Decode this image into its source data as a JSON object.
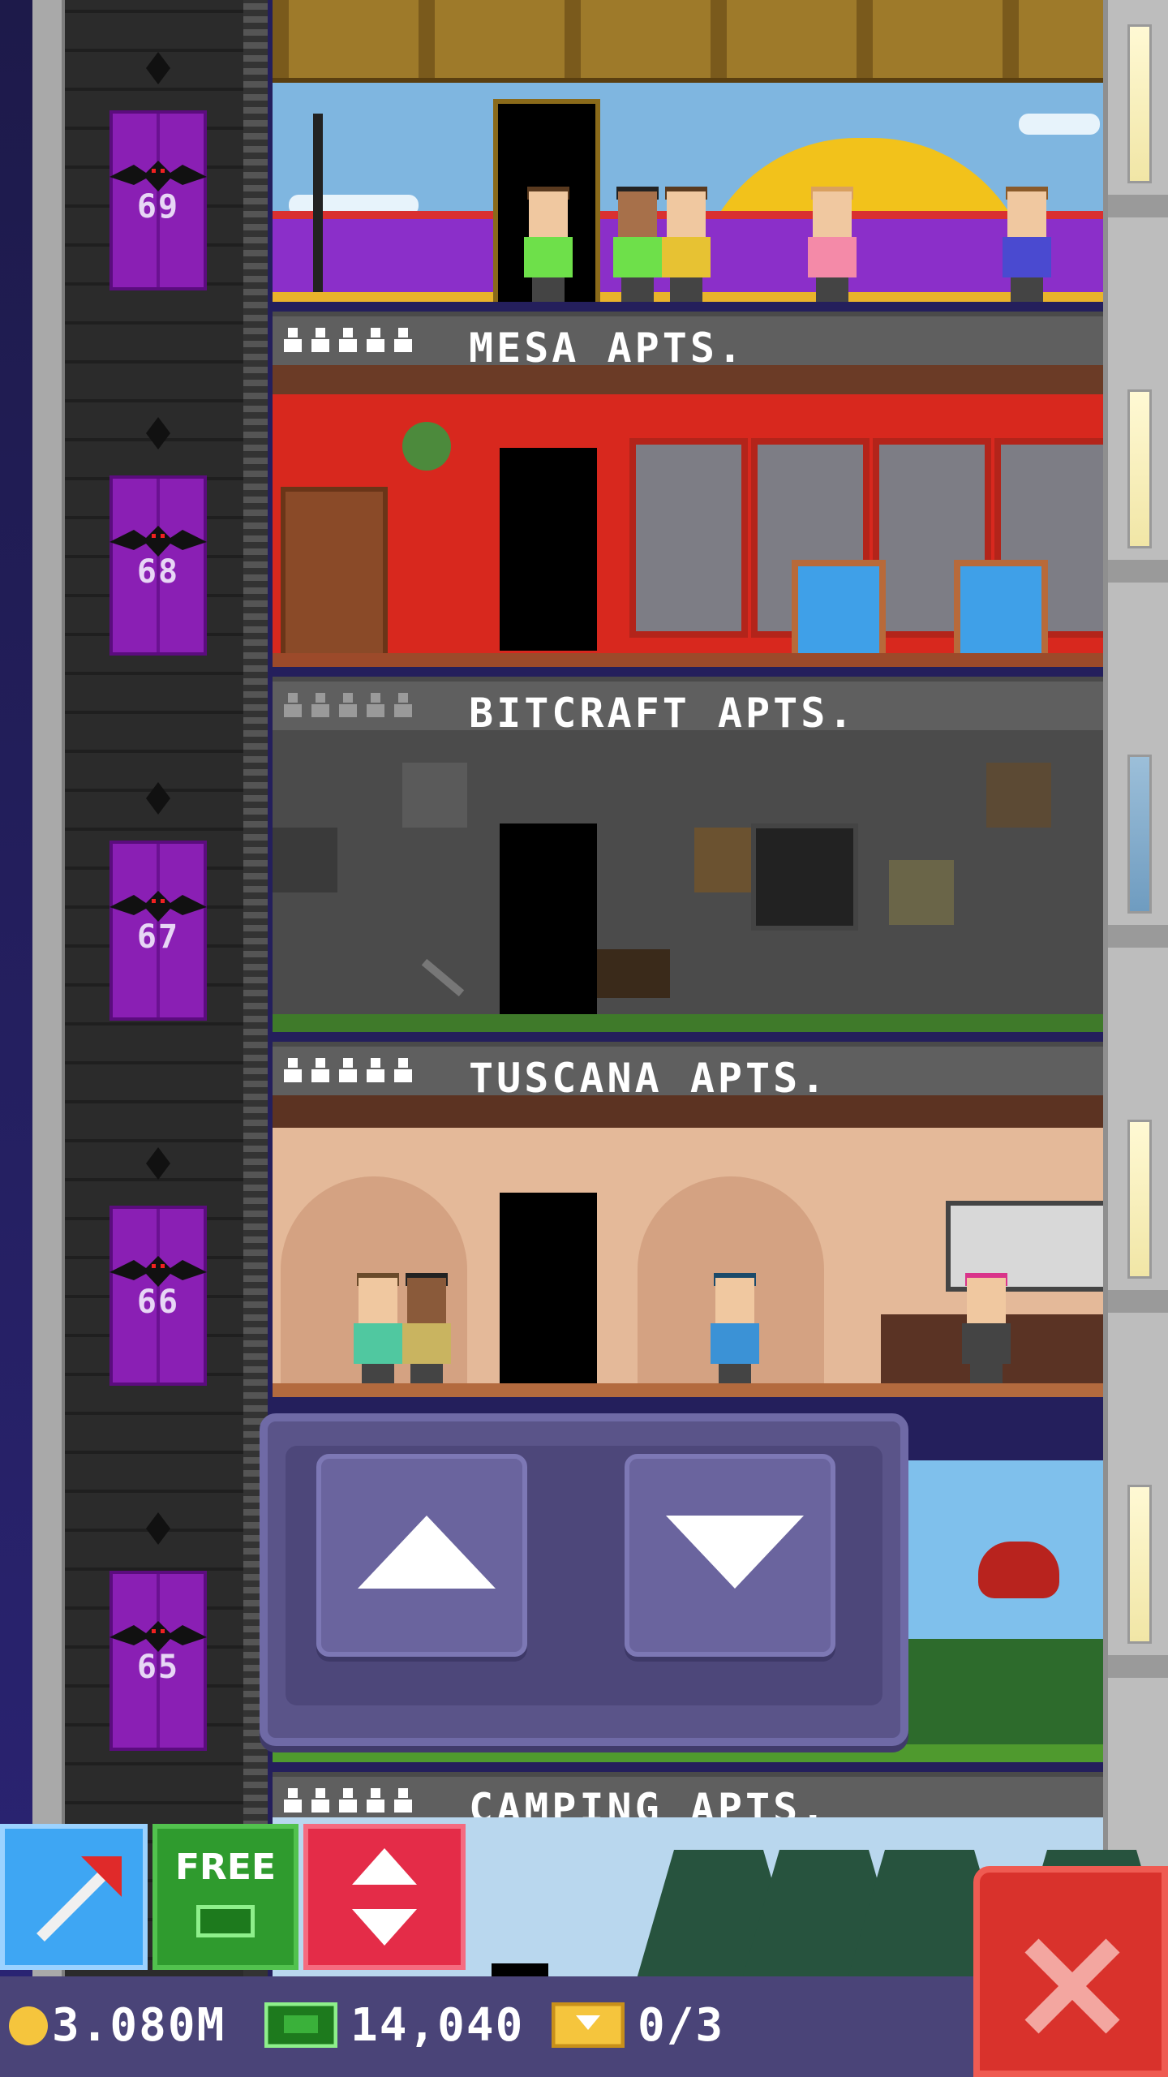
{
  "floors": [
    {
      "number": "69",
      "name": "MESA APTS.",
      "residents_filled": 5,
      "people_color": "#ffffff"
    },
    {
      "number": "68",
      "name": "BITCRAFT APTS.",
      "residents_filled": 0,
      "people_color": "#9a9a9a"
    },
    {
      "number": "67",
      "name": "TUSCANA APTS.",
      "residents_filled": 5,
      "people_color": "#ffffff"
    },
    {
      "number": "66",
      "name": "CAMPING APTS.",
      "residents_filled": 5,
      "people_color": "#ffffff"
    },
    {
      "number": "65"
    }
  ],
  "toolbar": {
    "dig_icon": "pickaxe-arrow-icon",
    "free_label": "FREE",
    "elevator_icon": "up-down-arrows-icon",
    "close_icon": "close-x-icon"
  },
  "status": {
    "coins": "3.080M",
    "bux": "14,040",
    "tickets": "0/3"
  },
  "elevator_control": {
    "up_icon": "arrow-up-icon",
    "down_icon": "arrow-down-icon"
  },
  "colors": {
    "elevator": "#8a1fb4",
    "control_panel": "#5a5489",
    "dig_button": "#3ea6f3",
    "free_button": "#2f9b2e",
    "elevator_button": "#e42c48",
    "close_button": "#d9322c"
  }
}
